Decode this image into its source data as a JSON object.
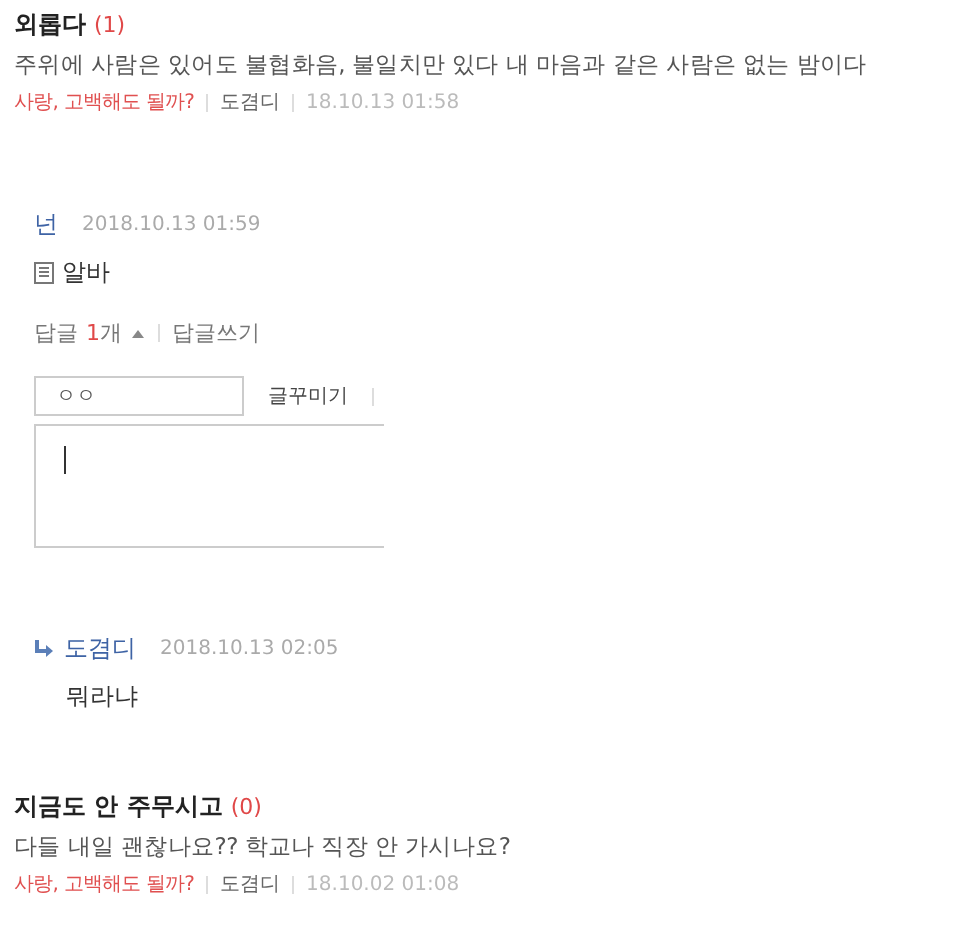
{
  "posts": [
    {
      "title": "외롭다",
      "count": "(1)",
      "body": "주위에 사람은 있어도  불협화음, 불일치만 있다   내 마음과 같은 사람은 없는 밤이다",
      "category": "사랑, 고백해도 될까?",
      "author": "도겸디",
      "date": "18.10.13 01:58"
    },
    {
      "title": "지금도 안 주무시고",
      "count": "(0)",
      "body": "다들 내일 괜찮나요??  학교나 직장 안 가시나요?",
      "category": "사랑, 고백해도 될까?",
      "author": "도겸디",
      "date": "18.10.02 01:08"
    }
  ],
  "comment": {
    "author": "넌",
    "date": "2018.10.13 01:59",
    "text": "알바",
    "replies_label": "답글",
    "replies_count": "1",
    "replies_unit": "개",
    "replies_expanded": true,
    "write_reply": "답글쓰기",
    "editor": {
      "name_value": "ㅇㅇ",
      "decorate_button": "글꾸미기"
    },
    "reply": {
      "author": "도겸디",
      "date": "2018.10.13 02:05",
      "text": "뭐라냐"
    }
  }
}
